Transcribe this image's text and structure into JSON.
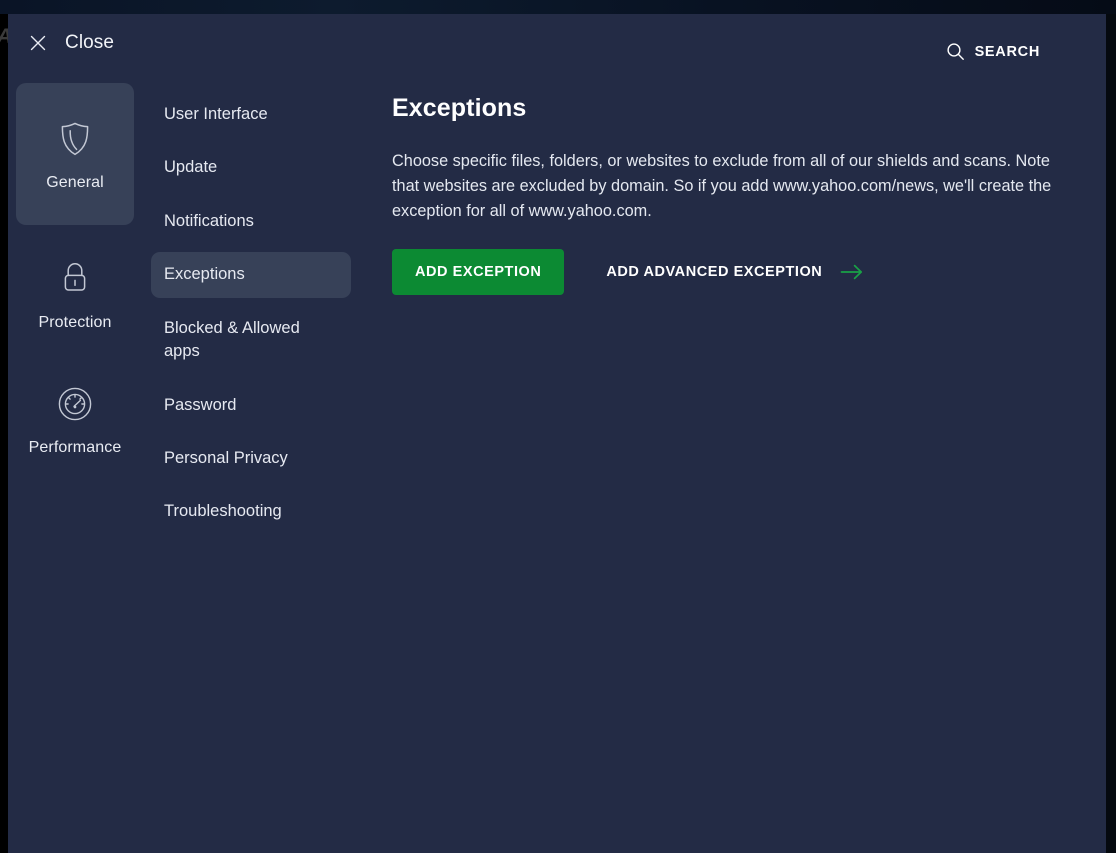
{
  "window": {
    "background_letter": "A",
    "panel_bg": "#232b45",
    "active_bg": "#374158",
    "accent_green": "#0c8a33"
  },
  "header": {
    "close_label": "Close",
    "close_icon": "close-icon",
    "search_label": "SEARCH",
    "search_icon": "search-icon"
  },
  "primary_nav": {
    "items": [
      {
        "label": "General",
        "icon": "shield-icon",
        "active": true
      },
      {
        "label": "Protection",
        "icon": "lock-icon",
        "active": false
      },
      {
        "label": "Performance",
        "icon": "speedometer-icon",
        "active": false
      }
    ]
  },
  "secondary_nav": {
    "items": [
      {
        "label": "User Interface",
        "active": false
      },
      {
        "label": "Update",
        "active": false
      },
      {
        "label": "Notifications",
        "active": false
      },
      {
        "label": "Exceptions",
        "active": true
      },
      {
        "label": "Blocked & Allowed apps",
        "active": false
      },
      {
        "label": "Password",
        "active": false
      },
      {
        "label": "Personal Privacy",
        "active": false
      },
      {
        "label": "Troubleshooting",
        "active": false
      }
    ]
  },
  "content": {
    "title": "Exceptions",
    "description": "Choose specific files, folders, or websites to exclude from all of our shields and scans. Note that websites are excluded by domain. So if you add www.yahoo.com/news, we'll create the exception for all of www.yahoo.com.",
    "add_exception_label": "ADD EXCEPTION",
    "add_advanced_exception_label": "ADD ADVANCED EXCEPTION",
    "advanced_arrow_icon": "arrow-right-icon"
  }
}
